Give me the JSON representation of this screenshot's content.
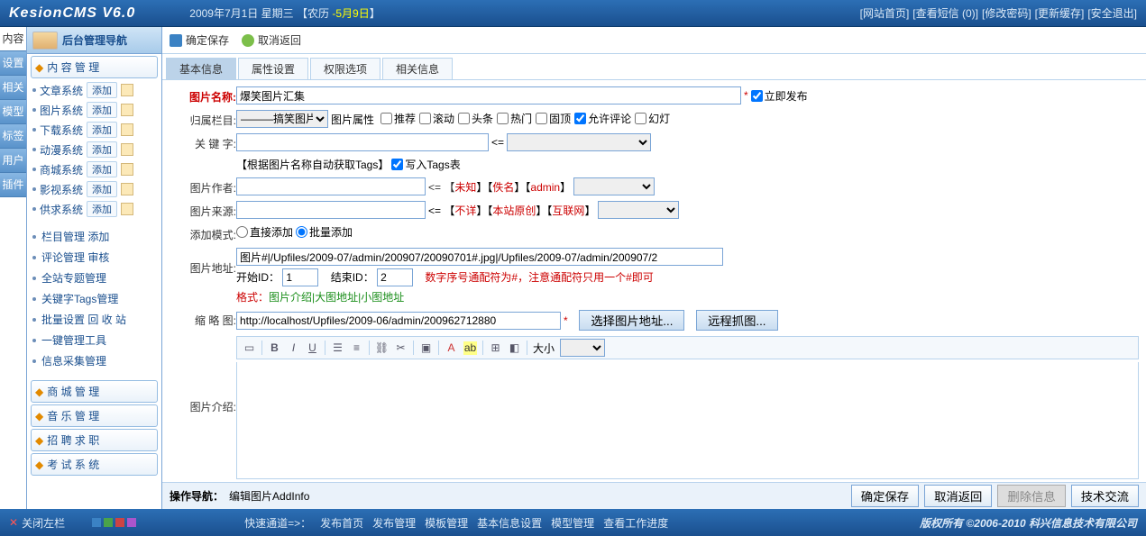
{
  "topbar": {
    "logo": "KesionCMS V6.0",
    "date": "2009年7月1日  星期三",
    "lunar_prefix": "【农历 ",
    "lunar": "-5月9日",
    "lunar_suffix": "】",
    "links": [
      "[网站首页]",
      "[查看短信 (",
      "0",
      ")]",
      "[修改密码]",
      "[更新缓存]",
      "[安全退出]"
    ]
  },
  "leftnav": {
    "title": "后台管理导航",
    "tabs": [
      "内容",
      "设置",
      "相关",
      "模型",
      "标签",
      "用户",
      "插件"
    ],
    "main_btn": "内 容 管 理",
    "systems": [
      {
        "name": "文章系统"
      },
      {
        "name": "图片系统"
      },
      {
        "name": "下载系统"
      },
      {
        "name": "动漫系统"
      },
      {
        "name": "商城系统"
      },
      {
        "name": "影视系统"
      },
      {
        "name": "供求系统"
      }
    ],
    "add_label": "添加",
    "plain_items": [
      "栏目管理 添加",
      "评论管理 审核",
      "全站专题管理",
      "关键字Tags管理",
      "批量设置 回 收 站",
      "一键管理工具",
      "信息采集管理"
    ],
    "extra_btns": [
      "商 城 管 理",
      "音 乐 管 理",
      "招 聘 求 职",
      "考 试 系 统"
    ]
  },
  "toolbar": {
    "save": "确定保存",
    "cancel": "取消返回"
  },
  "tabs": [
    "基本信息",
    "属性设置",
    "权限选项",
    "相关信息"
  ],
  "form": {
    "name_label": "图片名称:",
    "name_value": "爆笑图片汇集",
    "publish_now": "立即发布",
    "category_label": "归属栏目:",
    "category_value": "———搞笑图片",
    "pic_attrs_label": "图片属性",
    "attrs": [
      "推荐",
      "滚动",
      "头条",
      "热门",
      "固顶",
      "允许评论",
      "幻灯"
    ],
    "attrs_checked": [
      false,
      false,
      false,
      false,
      false,
      true,
      false
    ],
    "keyword_label": "关 键 字:",
    "keyword_hint": "【根据图片名称自动获取Tags】",
    "keyword_arrow": "<=",
    "write_tags": "写入Tags表",
    "author_label": "图片作者:",
    "author_opts_label": "<= 【未知】【佚名】【admin】",
    "source_label": "图片来源:",
    "source_opts_label": "<= 【不详】【本站原创】【互联网】",
    "add_mode_label": "添加模式:",
    "add_mode_single": "直接添加",
    "add_mode_batch": "批量添加",
    "pic_addr_label": "图片地址:",
    "pic_addr_value": "图片#|/Upfiles/2009-07/admin/200907/20090701#.jpg|/Upfiles/2009-07/admin/200907/2",
    "start_id_label": "开始ID：",
    "start_id": "1",
    "end_id_label": "结束ID：",
    "end_id": "2",
    "id_hint": "数字序号通配符为#，注意通配符只用一个#即可",
    "format_hint_label": "格式：",
    "format_hint": "图片介绍|大图地址|小图地址",
    "thumb_label": "缩 略 图:",
    "thumb_value": "http://localhost/Upfiles/2009-06/admin/200962712880",
    "select_pic_btn": "选择图片地址...",
    "remote_grab_btn": "远程抓图...",
    "editor_size_label": "大小",
    "intro_label": "图片介绍:"
  },
  "actionbar": {
    "nav_label": "操作导航：",
    "nav_text": "编辑图片AddInfo",
    "save": "确定保存",
    "cancel": "取消返回",
    "delete": "删除信息",
    "tech": "技术交流"
  },
  "footer": {
    "close": "关闭左栏",
    "quick_label": "快速通道=>：",
    "quick_links": [
      "发布首页",
      "发布管理",
      "模板管理",
      "基本信息设置",
      "模型管理",
      "查看工作进度"
    ],
    "copyright": "版权所有  ©2006-2010 科兴信息技术有限公司"
  }
}
